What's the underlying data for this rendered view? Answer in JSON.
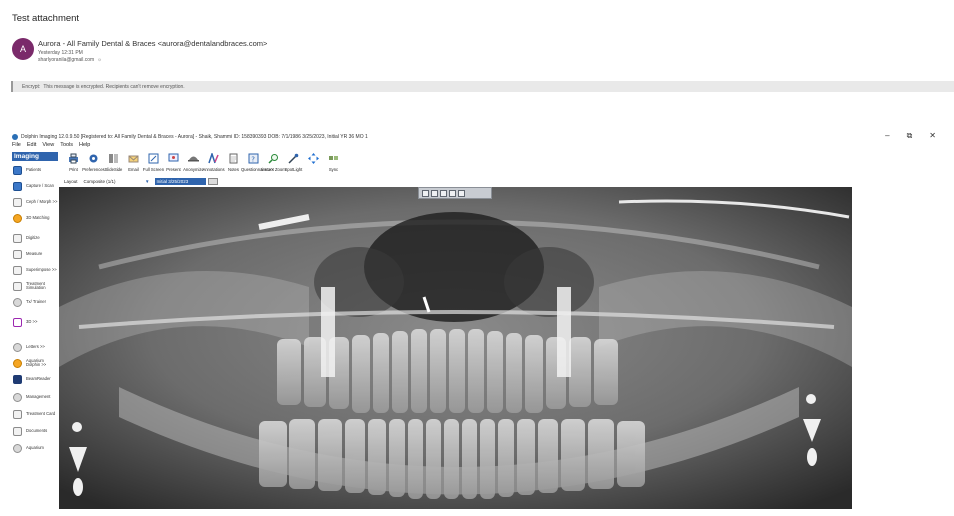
{
  "email": {
    "subject": "Test attachment",
    "avatar_initial": "A",
    "sender": "Aurora - All Family Dental & Braces <aurora@dentalandbraces.com>",
    "time": "Yesterday 12:31 PM",
    "recipient": "sharlyoranila@gmail.com",
    "recipient_icon": "☼",
    "banner_label": "Encrypt:",
    "banner_text": "This message is encrypted. Recipients can't remove encryption."
  },
  "window": {
    "title": "Dolphin Imaging 12.0.9.50 [Registered to: All Family Dental & Braces - Aurora] - Shaik, Shammi ID: 158390393 DOB: 7/1/1986 3/25/2023, Initial  YR 36  MO 1",
    "minimize_glyph": "–",
    "restore_glyph": "⧉",
    "close_glyph": "✕",
    "menu": [
      "File",
      "Edit",
      "View",
      "Tools",
      "Help"
    ]
  },
  "sidebar": {
    "header": "Imaging",
    "items": [
      {
        "label": "Patients",
        "icon": "patients-icon"
      },
      {
        "label": "Capture / Scan",
        "icon": "capture-icon"
      },
      {
        "label": "Ceph / Morph >>",
        "icon": "ceph-icon"
      },
      {
        "label": "3D Matching",
        "icon": "3d-matching-icon"
      },
      {
        "label": "Digitize",
        "icon": "digitize-icon"
      },
      {
        "label": "Measure",
        "icon": "measure-icon"
      },
      {
        "label": "Superimpose >>",
        "icon": "superimpose-icon"
      },
      {
        "label": "Treatment Simulation",
        "icon": "treatment-simulation-icon"
      },
      {
        "label": "Tx/ Trainer",
        "icon": "trainer-icon"
      },
      {
        "label": "3D >>",
        "icon": "3d-icon"
      },
      {
        "label": "Letters >>",
        "icon": "letters-icon"
      },
      {
        "label": "Aquarium Dolphin >>",
        "icon": "aquarium-icon"
      },
      {
        "label": "BeamReader",
        "icon": "beamreader-icon"
      },
      {
        "label": "Management",
        "icon": "management-icon"
      },
      {
        "label": "Treatment Card",
        "icon": "treatment-card-icon"
      },
      {
        "label": "Documents",
        "icon": "documents-icon"
      },
      {
        "label": "Aquarium",
        "icon": "aquarium-icon"
      }
    ]
  },
  "toolbar": {
    "items": [
      {
        "label": "Print",
        "icon": "printer-icon"
      },
      {
        "label": "Preferences",
        "icon": "gear-icon"
      },
      {
        "label": "SlideSide",
        "icon": "slideside-icon"
      },
      {
        "label": "Email",
        "icon": "email-icon"
      },
      {
        "label": "Full Screen",
        "icon": "fullscreen-icon"
      },
      {
        "label": "Present",
        "icon": "present-icon"
      },
      {
        "label": "Anonymize",
        "icon": "anonymize-icon"
      },
      {
        "label": "Annotations",
        "icon": "annotations-icon"
      },
      {
        "label": "Notes",
        "icon": "notes-icon"
      },
      {
        "label": "Questionnaire >>",
        "icon": "questionnaire-icon"
      },
      {
        "label": "Instant Zoom",
        "icon": "zoom-icon"
      },
      {
        "label": "SpotLight",
        "icon": "spotlight-icon"
      },
      {
        "label": "",
        "icon": "move-arrows-icon"
      },
      {
        "label": "Sync",
        "icon": "sync-icon"
      }
    ]
  },
  "layout": {
    "label": "Layout",
    "value": "Composite (1/1)",
    "visit": "Initial 3/25/2023"
  },
  "image": {
    "type": "panoramic dental x-ray",
    "toolbar_icons": [
      "zoom-in-icon",
      "zoom-out-icon",
      "fit-icon",
      "rotate-icon",
      "close-icon"
    ]
  }
}
